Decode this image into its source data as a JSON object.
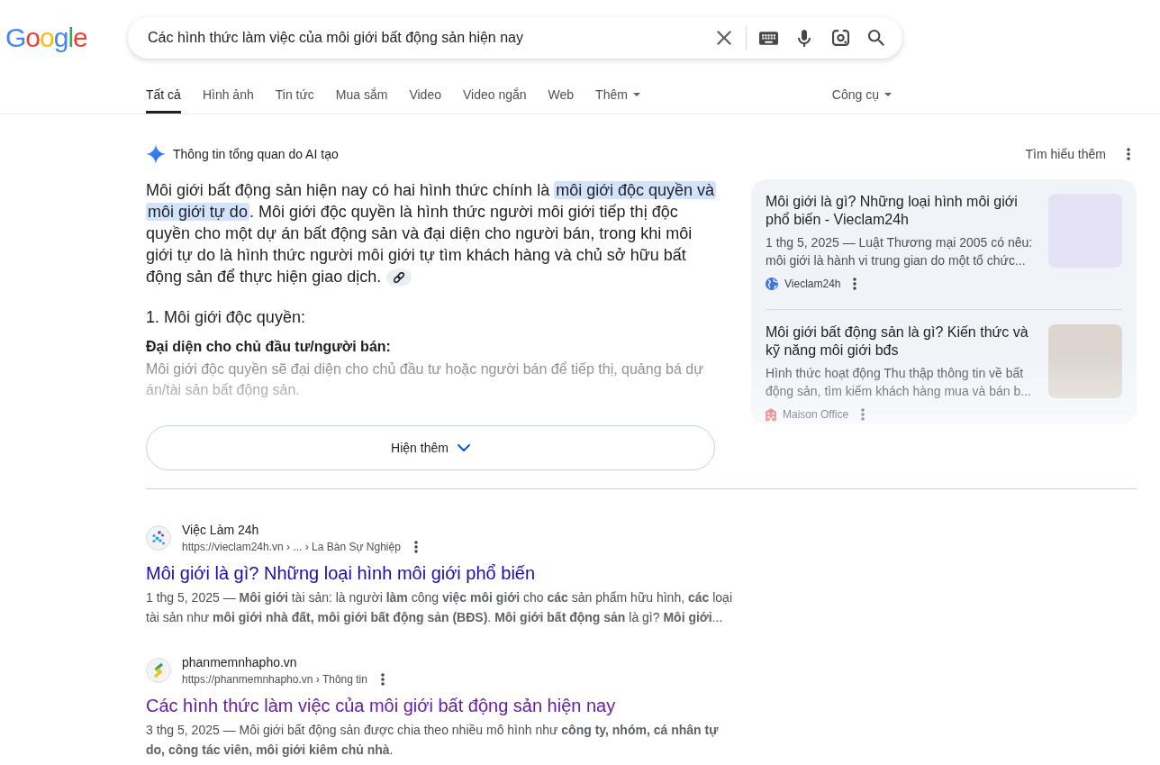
{
  "logo": {
    "text": "Google"
  },
  "search": {
    "value": "Các hình thức làm việc của môi giới bất động sản hiện nay"
  },
  "tabs": [
    {
      "label": "Tất cả",
      "selected": true,
      "kind": "link"
    },
    {
      "label": "Hình ảnh",
      "selected": false,
      "kind": "link"
    },
    {
      "label": "Tin tức",
      "selected": false,
      "kind": "link"
    },
    {
      "label": "Mua sắm",
      "selected": false,
      "kind": "link"
    },
    {
      "label": "Video",
      "selected": false,
      "kind": "link"
    },
    {
      "label": "Video ngắn",
      "selected": false,
      "kind": "link"
    },
    {
      "label": "Web",
      "selected": false,
      "kind": "link"
    },
    {
      "label": "Thêm",
      "selected": false,
      "kind": "menu"
    }
  ],
  "tools": {
    "label": "Công cụ"
  },
  "ai_overview": {
    "title": "Thông tin tổng quan do AI tạo",
    "learn_more": "Tìm hiểu thêm",
    "summary": [
      {
        "text": "Môi giới bất động sản hiện nay có hai hình thức chính là ",
        "highlighted": false
      },
      {
        "text": "môi giới độc quyền và môi giới tự do",
        "highlighted": true
      },
      {
        "text": ". Môi giới độc quyền là hình thức người môi giới tiếp thị độc quyền cho một dự án bất động sản và đại diện cho người bán, trong khi môi giới tự do là hình thức người môi giới tự tìm khách hàng và chủ sở hữu bất động sản để thực hiện giao dịch.",
        "highlighted": false
      }
    ],
    "heading": "1. Môi giới độc quyền:",
    "subheading": "Đại diện cho chủ đầu tư/người bán:",
    "detail": "Môi giới độc quyền sẽ đại diện cho chủ đầu tư hoặc người bán để tiếp thị, quảng bá dự án/tài sản bất động sản.",
    "show_more": "Hiện thêm",
    "sources": [
      {
        "kind": "globe",
        "title": "Môi giới là gì? Những loại hình môi giới phổ biến - Vieclam24h",
        "snippet": "1 thg 5, 2025 — Luật Thương mại 2005 có nêu: môi giới là hành vi trung gian do một tổ chức...",
        "source": "Vieclam24h"
      },
      {
        "kind": "building",
        "title": "Môi giới bất động sản là gì? Kiến thức và kỹ năng môi giới bđs",
        "snippet": "Hình thức hoạt động Thu thập thông tin về bất động sản, tìm kiếm khách hàng mua và bán b...",
        "source": "Maison Office"
      }
    ]
  },
  "results": [
    {
      "kind": "dots",
      "site": "Việc Làm 24h",
      "url": "https://vieclam24h.vn › ... › La Bàn Sự Nghiệp",
      "title": "Môi giới là gì? Những loại hình môi giới phổ biến",
      "visited": false,
      "snippet": "1 thg 5, 2025 — **Môi giới** tài sản: là người **làm** công **việc môi giới** cho **các** sản phẩm hữu hình, **các** loại tài sản như **môi giới nhà đất, môi giới bất động sản (BĐS)**. **Môi giới bất động sản** là gì? **Môi giới**..."
    },
    {
      "kind": "chevrons",
      "site": "phanmemnhapho.vn",
      "url": "https://phanmemnhapho.vn › Thông tin",
      "title": "Các hình thức làm việc của môi giới bất động sản hiện nay",
      "visited": true,
      "snippet": "3 thg 5, 2025 — Môi giới bất động sản được chia theo nhiều mô hình như **công ty, nhóm, cá nhân tự do, công tác viên, môi giới kiêm chủ nhà**."
    }
  ]
}
